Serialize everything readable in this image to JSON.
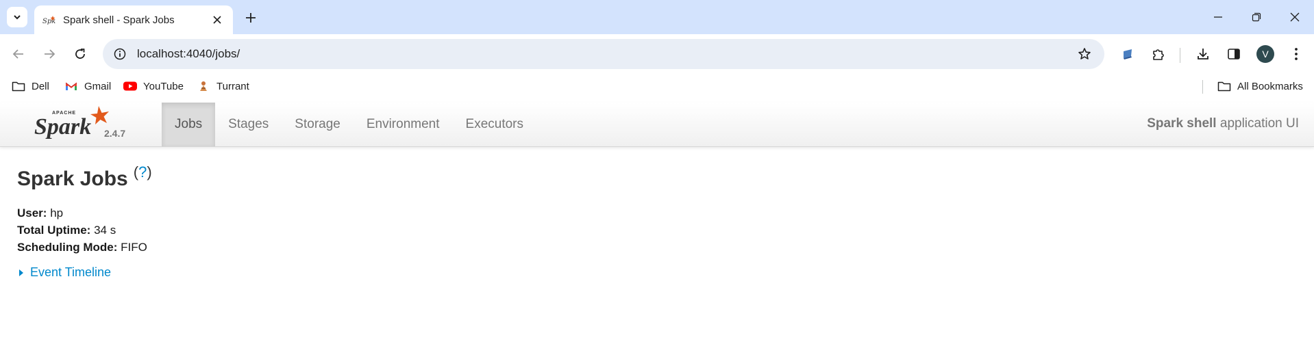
{
  "browser": {
    "tab_title": "Spark shell - Spark Jobs",
    "url": "localhost:4040/jobs/",
    "avatar_initial": "V",
    "bookmarks": [
      {
        "label": "Dell",
        "icon": "folder-icon"
      },
      {
        "label": "Gmail",
        "icon": "gmail-icon"
      },
      {
        "label": "YouTube",
        "icon": "youtube-icon"
      },
      {
        "label": "Turrant",
        "icon": "turrant-icon"
      }
    ],
    "all_bookmarks_label": "All Bookmarks"
  },
  "spark": {
    "logo_text": "Spark",
    "logo_apache": "APACHE",
    "version": "2.4.7",
    "nav": [
      {
        "label": "Jobs",
        "active": true
      },
      {
        "label": "Stages",
        "active": false
      },
      {
        "label": "Storage",
        "active": false
      },
      {
        "label": "Environment",
        "active": false
      },
      {
        "label": "Executors",
        "active": false
      }
    ],
    "app_name": "Spark shell",
    "app_suffix": "application UI"
  },
  "page": {
    "title": "Spark Jobs",
    "help_open": "(",
    "help_link": "?",
    "help_close": ")",
    "user_label": "User:",
    "user_value": "hp",
    "uptime_label": "Total Uptime:",
    "uptime_value": "34 s",
    "mode_label": "Scheduling Mode:",
    "mode_value": "FIFO",
    "timeline_label": "Event Timeline"
  },
  "colors": {
    "link": "#0088cc",
    "tabstrip": "#d3e3fd",
    "spark_orange": "#e25a1c"
  }
}
